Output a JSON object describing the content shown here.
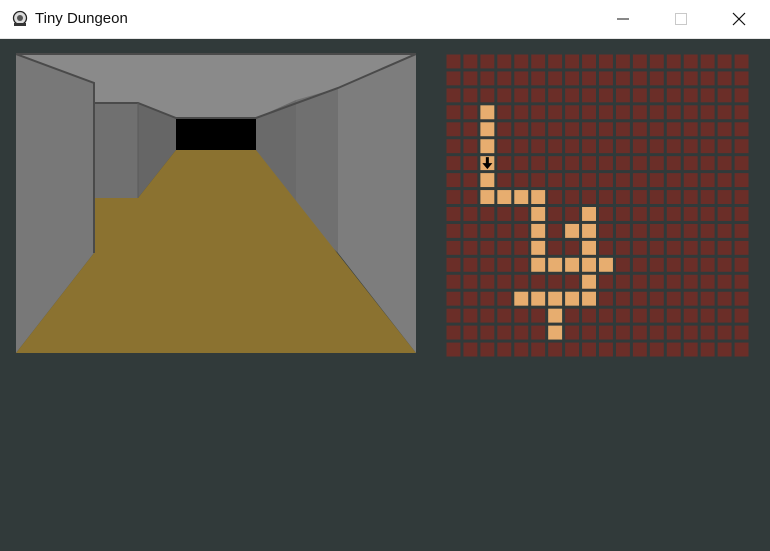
{
  "window": {
    "title": "Tiny Dungeon",
    "icon": "dungeon-app-icon",
    "controls": [
      "minimize-icon",
      "maximize-icon",
      "close-icon"
    ]
  },
  "colors": {
    "background": "#313a3a",
    "floor": "#8b7230",
    "wall_light": "#7a7a7a",
    "wall_mid": "#6a6a6a",
    "wall_dark": "#5f5f5f",
    "ceiling": "#878787",
    "void": "#000000",
    "map_wall": "#6b2e28",
    "map_floor": "#e7ad6f",
    "player": "#000000"
  },
  "map": {
    "cols": 18,
    "rows": 18,
    "visited_floor_cells": [
      [
        2,
        3
      ],
      [
        2,
        4
      ],
      [
        2,
        5
      ],
      [
        2,
        6
      ],
      [
        2,
        7
      ],
      [
        2,
        8
      ],
      [
        3,
        8
      ],
      [
        4,
        8
      ],
      [
        5,
        8
      ],
      [
        5,
        9
      ],
      [
        8,
        9
      ],
      [
        5,
        10
      ],
      [
        7,
        10
      ],
      [
        8,
        10
      ],
      [
        5,
        11
      ],
      [
        8,
        11
      ],
      [
        5,
        12
      ],
      [
        6,
        12
      ],
      [
        7,
        12
      ],
      [
        8,
        12
      ],
      [
        9,
        12
      ],
      [
        8,
        13
      ],
      [
        4,
        14
      ],
      [
        5,
        14
      ],
      [
        6,
        14
      ],
      [
        7,
        14
      ],
      [
        8,
        14
      ],
      [
        6,
        15
      ],
      [
        6,
        16
      ]
    ],
    "player": {
      "col": 2,
      "row": 6,
      "facing": "south",
      "icon": "down-arrow-icon"
    }
  }
}
